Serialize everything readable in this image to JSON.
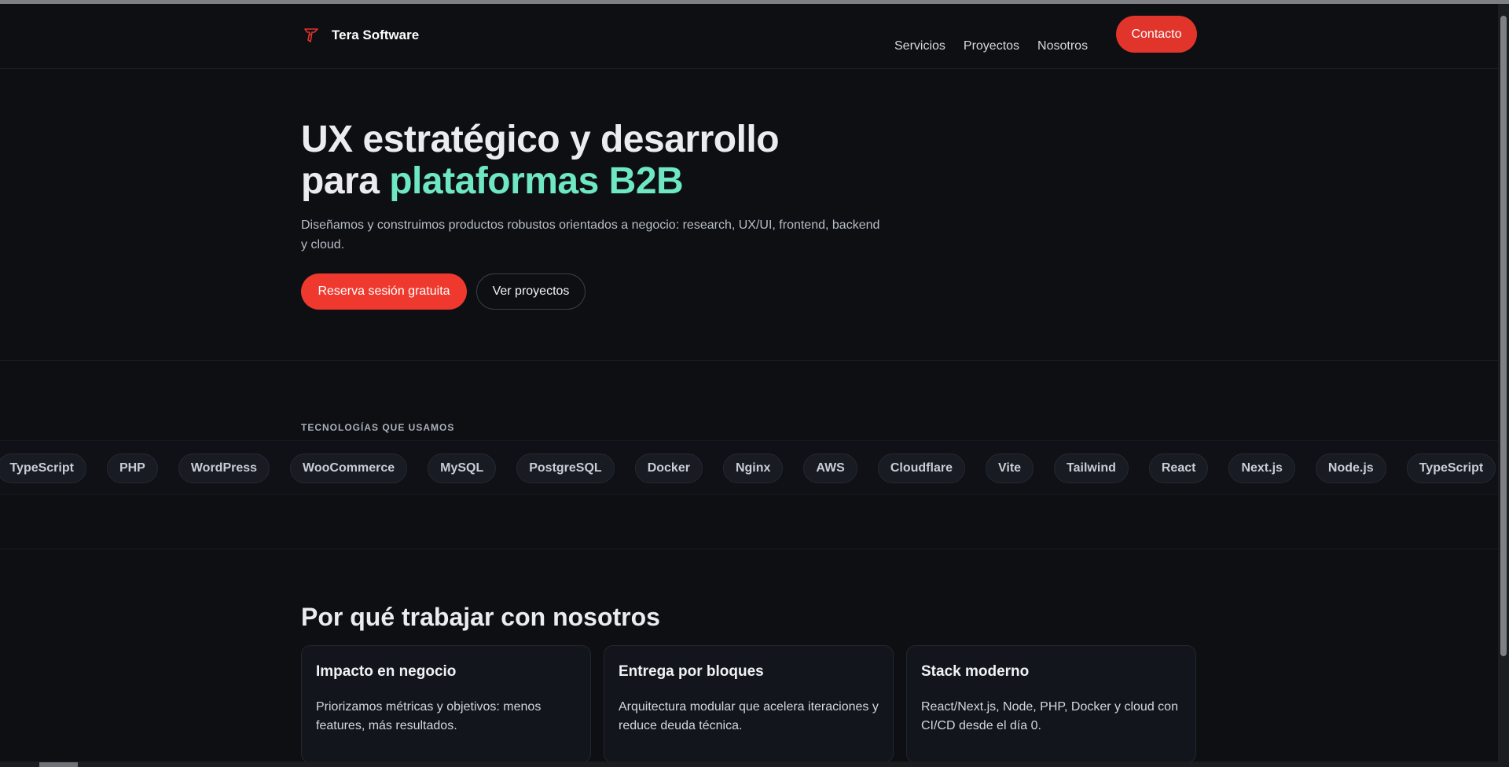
{
  "header": {
    "brand": "Tera Software",
    "logo_icon": "tera-flame-logo-icon",
    "nav": [
      "Servicios",
      "Proyectos",
      "Nosotros"
    ],
    "contact_label": "Contacto"
  },
  "hero": {
    "title_line1": "UX estratégico y desarrollo",
    "title_line2_prefix": "para ",
    "title_line2_accent": "plataformas B2B",
    "subtitle": "Diseñamos y construimos productos robustos orientados a negocio: research, UX/UI, frontend, backend y cloud.",
    "primary_cta": "Reserva sesión gratuita",
    "secondary_cta": "Ver proyectos"
  },
  "tech": {
    "label": "TECNOLOGÍAS QUE USAMOS",
    "items": [
      "TypeScript",
      "PHP",
      "WordPress",
      "WooCommerce",
      "MySQL",
      "PostgreSQL",
      "Docker",
      "Nginx",
      "AWS",
      "Cloudflare",
      "Vite",
      "Tailwind",
      "React",
      "Next.js",
      "Node.js",
      "TypeScript"
    ]
  },
  "why": {
    "title": "Por qué trabajar con nosotros",
    "cards": [
      {
        "title": "Impacto en negocio",
        "body": "Priorizamos métricas y objetivos: menos features, más resultados."
      },
      {
        "title": "Entrega por bloques",
        "body": "Arquitectura modular que acelera iteraciones y reduce deuda técnica."
      },
      {
        "title": "Stack moderno",
        "body": "React/Next.js, Node, PHP, Docker y cloud con CI/CD desde el día 0."
      }
    ]
  },
  "colors": {
    "background": "#0d0f13",
    "accent_red": "#e1352c",
    "accent_teal": "#6ee7c2"
  }
}
